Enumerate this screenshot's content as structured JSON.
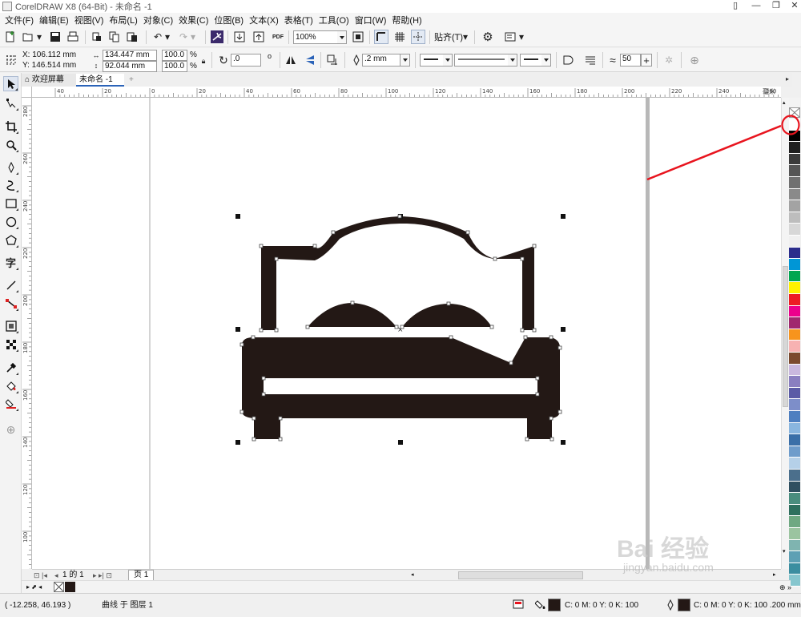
{
  "window": {
    "title": "CorelDRAW X8 (64-Bit) - 未命名 -1",
    "controls": [
      "▯",
      "—",
      "❐",
      "✕"
    ]
  },
  "menu": [
    "文件(F)",
    "编辑(E)",
    "视图(V)",
    "布局(L)",
    "对象(C)",
    "效果(C)",
    "位图(B)",
    "文本(X)",
    "表格(T)",
    "工具(O)",
    "窗口(W)",
    "帮助(H)"
  ],
  "toolbar_standard": {
    "zoom": "100%",
    "snap_label": "贴齐(T)",
    "pdf_label": "PDF"
  },
  "property_bar": {
    "x": "X: 106.112 mm",
    "y": "Y: 146.514 mm",
    "width": "134.447 mm",
    "height": "92.044 mm",
    "scale_x": "100.0",
    "scale_y": "100.0",
    "percent": "%",
    "rotation": ".0",
    "degree": "o",
    "outline_width": ".2 mm",
    "smoothing": "50"
  },
  "tabs": {
    "welcome": "欢迎屏幕",
    "document": "未命名 -1",
    "add": "+"
  },
  "ruler": {
    "h_labels": [
      "40",
      "20",
      "0",
      "20",
      "40",
      "60",
      "80",
      "100",
      "120",
      "140",
      "160",
      "180",
      "200",
      "220",
      "240",
      "260"
    ],
    "v_labels": [
      "280",
      "260",
      "240",
      "220",
      "200",
      "180",
      "160",
      "140",
      "120",
      "100"
    ],
    "h_unit": "毫米",
    "v_unit": "毫米"
  },
  "doc_nav": {
    "pages": "1 的 1",
    "page_tab": "页 1"
  },
  "status": {
    "cursor": "( -12.258, 46.193 )",
    "selection": "曲线 于 图层 1",
    "fill_text": "C: 0 M: 0 Y: 0 K: 100",
    "outline_text": "C: 0 M: 0 Y: 0 K: 100 .200 mm"
  },
  "watermark": {
    "logo": "Bai 经验",
    "url": "jingyan.baidu.com"
  },
  "colors": {
    "object_fill": "#231815",
    "annotation": "#e8141e",
    "palette": [
      "#ffffff",
      "#000000",
      "#1f1f1f",
      "#3a3a3a",
      "#555555",
      "#707070",
      "#8a8a8a",
      "#a3a3a3",
      "#bdbdbd",
      "#d7d7d7",
      "#f0f0f0",
      "#2b2d8c",
      "#0096d6",
      "#00a650",
      "#fff200",
      "#ed1c24",
      "#ec008c",
      "#a0286e",
      "#f7941d",
      "#f7b2b2",
      "#7b4a2e",
      "#c9b8de",
      "#8a7fc0",
      "#5b5ba6",
      "#7d8ec9",
      "#4e7fc0",
      "#8ab6df",
      "#3a6fa8",
      "#6e9ccb",
      "#b5d0e8",
      "#4b6f8c",
      "#2f4f5f",
      "#4a8d7e",
      "#2e6f5e",
      "#6fa882",
      "#9bc4a0",
      "#7fb4b0",
      "#5ea0b4",
      "#3b8ea0",
      "#86c6ce"
    ]
  }
}
